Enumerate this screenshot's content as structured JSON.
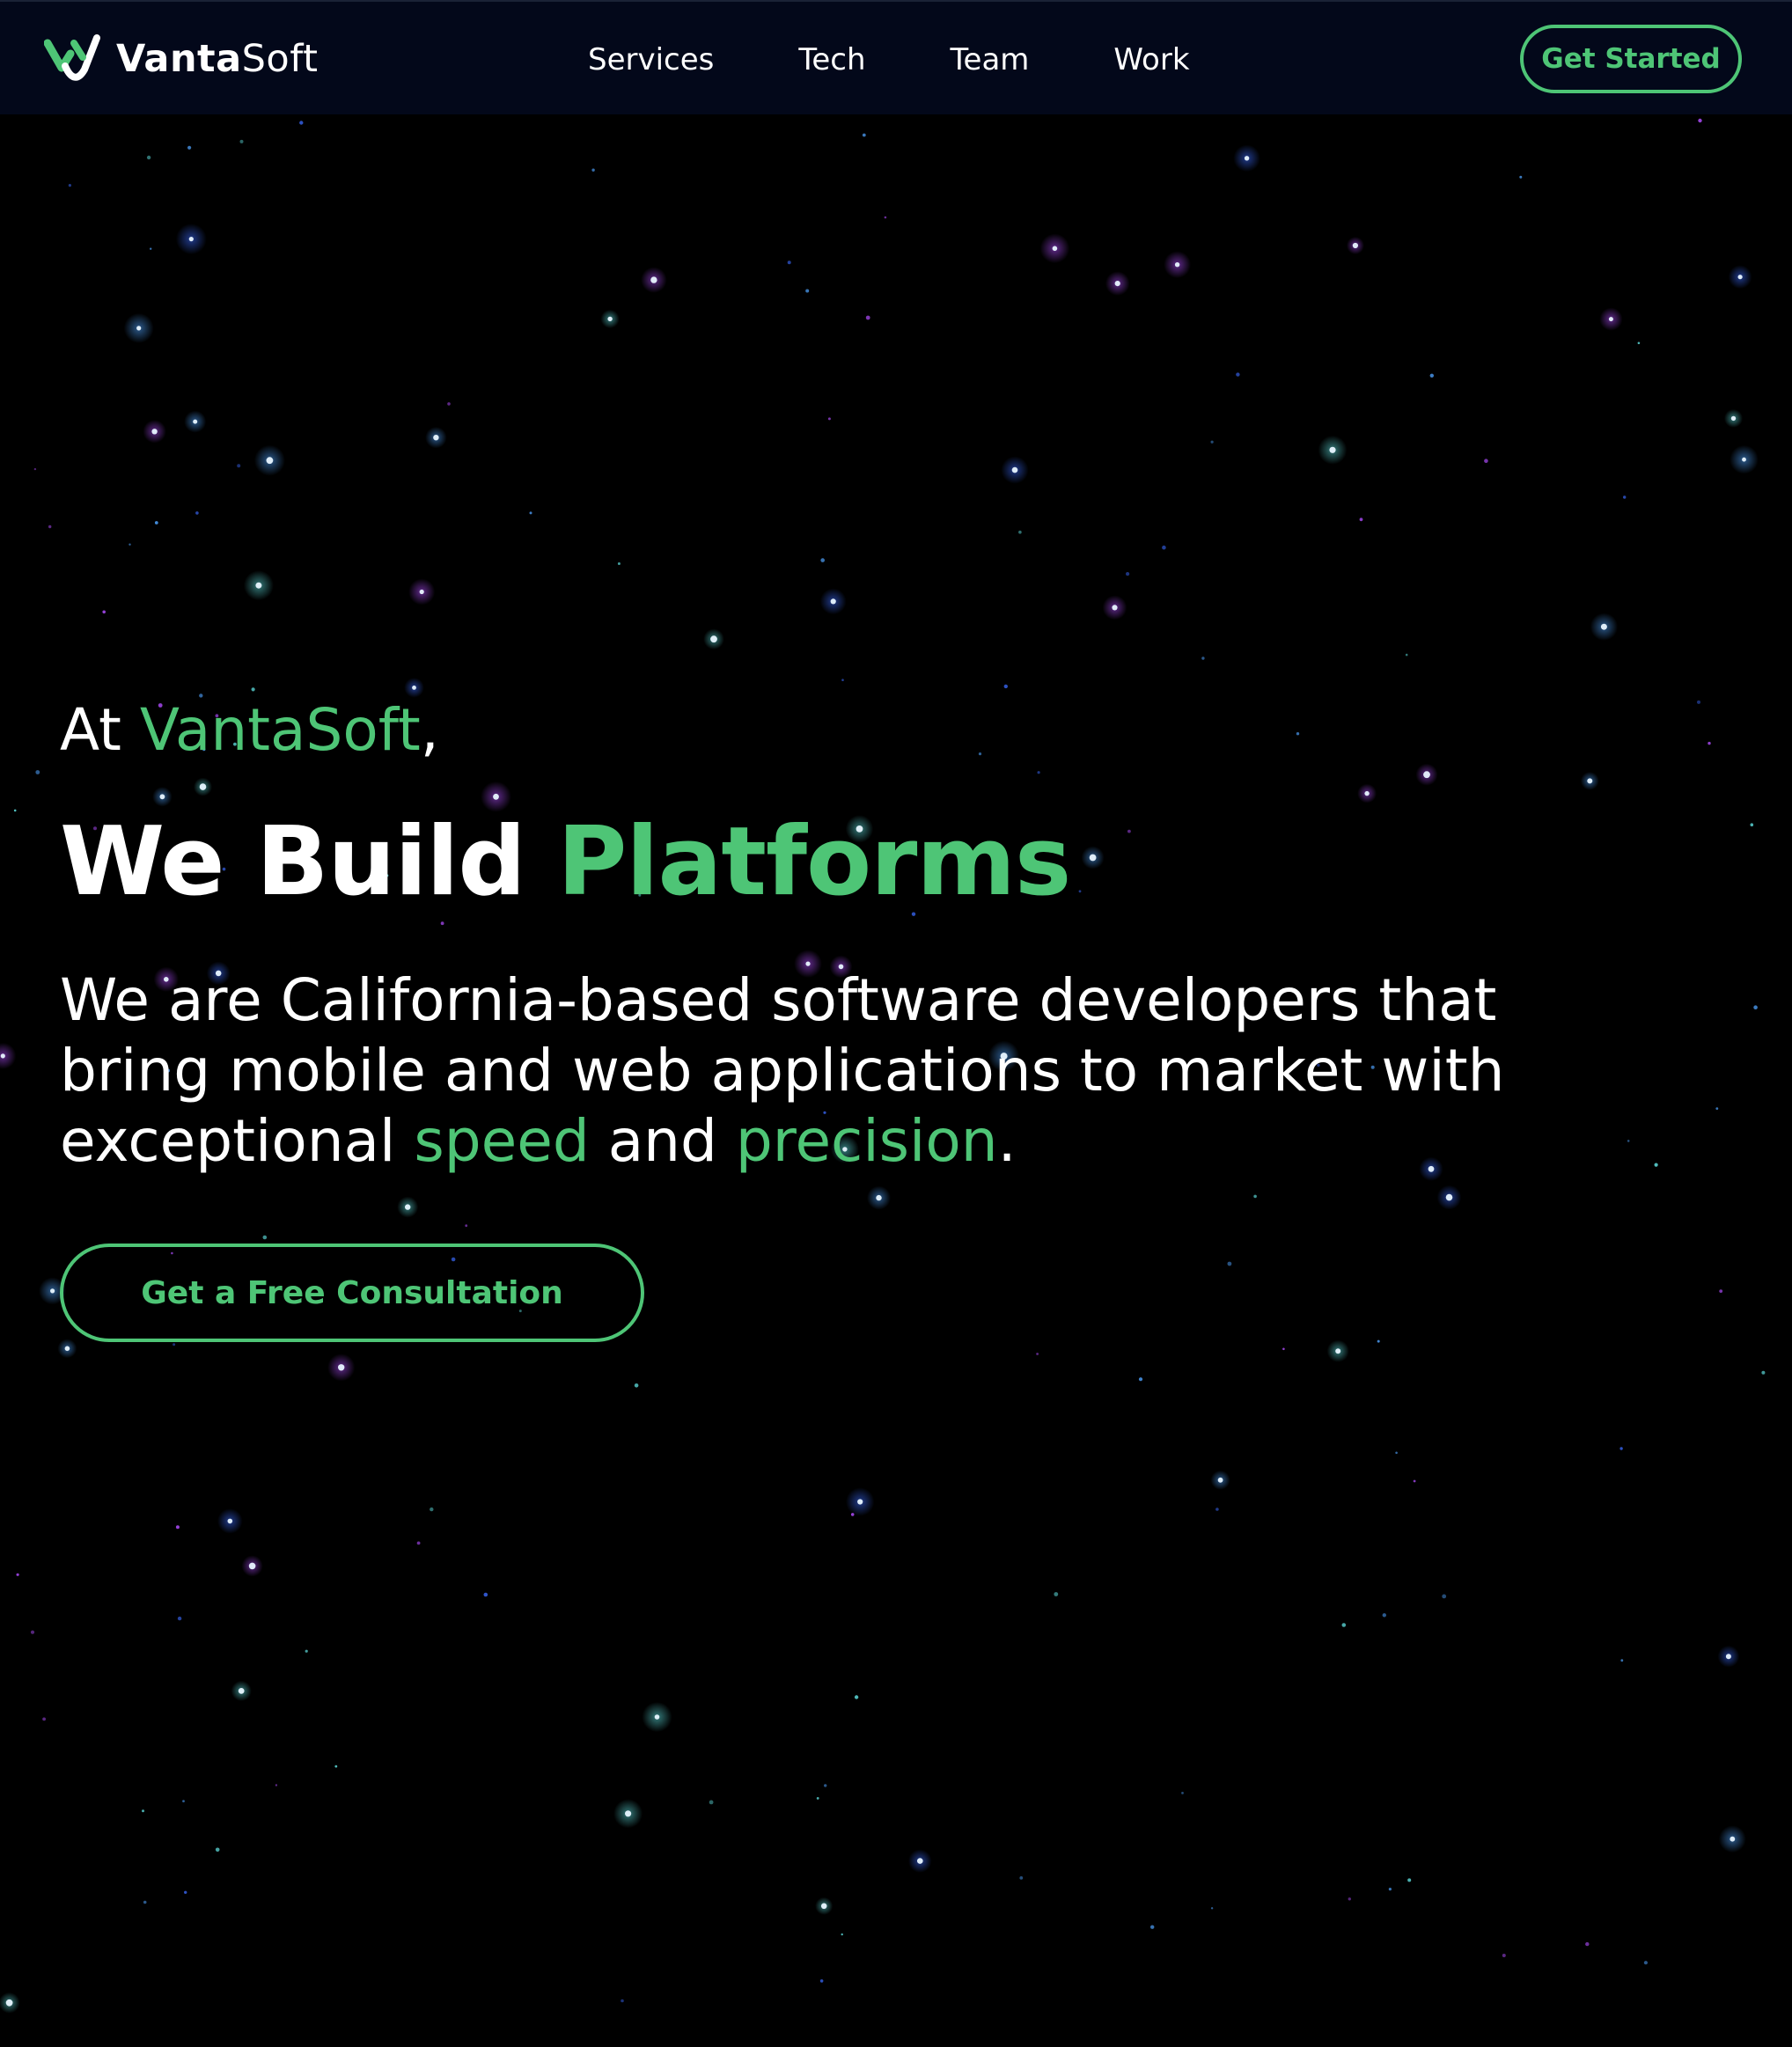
{
  "header": {
    "brand": {
      "strong": "Vanta",
      "light": "Soft",
      "logo_icon": "vantasoft-logo-icon"
    },
    "nav": [
      {
        "label": "Services"
      },
      {
        "label": "Tech"
      },
      {
        "label": "Team"
      },
      {
        "label": "Work"
      }
    ],
    "cta_label": "Get Started"
  },
  "hero": {
    "intro_prefix": "At ",
    "intro_brand": "VantaSoft",
    "intro_suffix": ",",
    "headline_white": "We Build ",
    "headline_accent": "Platforms",
    "lead_line1": "We are California-based software developers that",
    "lead_line2": "bring mobile and web applications to market with",
    "lead_line3_a": "exceptional ",
    "lead_line3_speed": "speed",
    "lead_line3_b": " and ",
    "lead_line3_precision": "precision",
    "lead_line3_c": ".",
    "cta_label": "Get a Free Consultation"
  },
  "theme": {
    "accent": "#4ec576",
    "background": "#000000",
    "nav_background": "#03081a",
    "star_colors": [
      "#4fa3ff",
      "#b04dff",
      "#5fe0e0",
      "#3b6bff"
    ]
  }
}
